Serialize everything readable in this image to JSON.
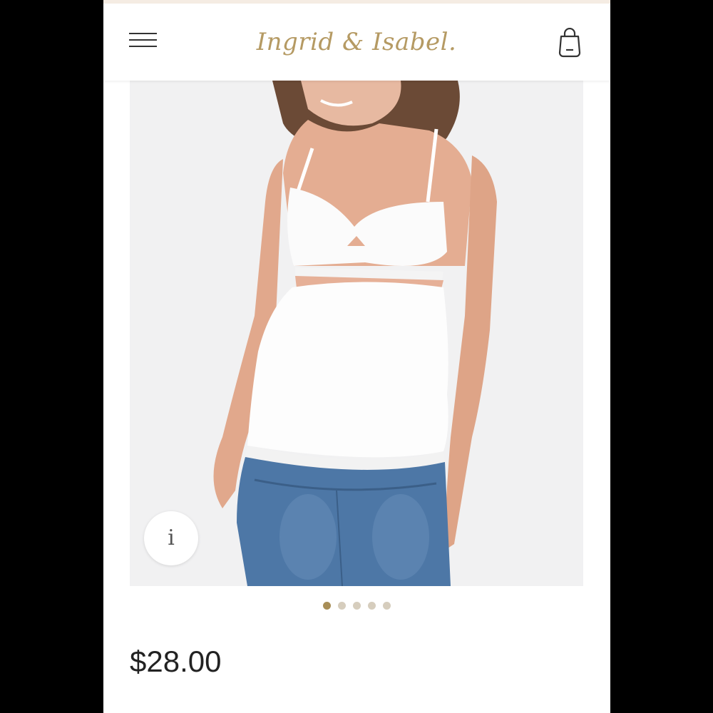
{
  "header": {
    "menu_icon": "hamburger-menu-icon",
    "logo_text": "Ingrid & Isabel",
    "logo_mark": ".",
    "bag_icon": "shopping-bag-icon"
  },
  "product": {
    "image_description_icon": "info-icon",
    "info_glyph": "i",
    "carousel": {
      "count": 5,
      "active_index": 0
    },
    "price": "$28.00"
  },
  "colors": {
    "brand_gold": "#b59a63",
    "dot_active": "#a88e57",
    "dot_inactive": "#d6cdbd",
    "image_background": "#f1f1f2"
  }
}
